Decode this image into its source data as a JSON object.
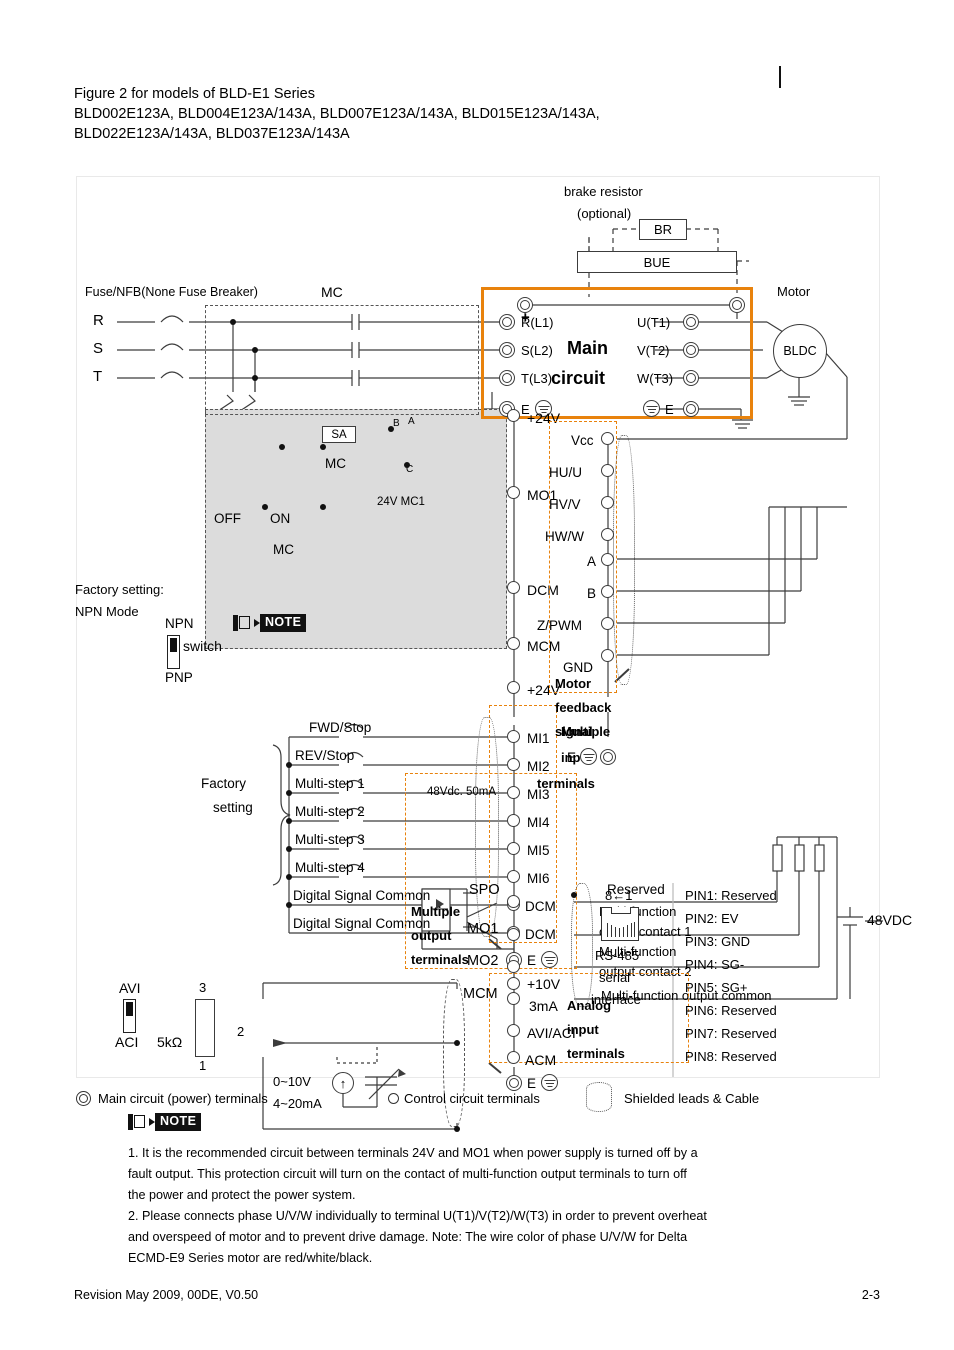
{
  "header": {
    "line1": "Figure 2 for models of BLD-E1 Series",
    "line2": "BLD002E123A, BLD004E123A/143A, BLD007E123A/143A, BLD015E123A/143A,",
    "line3": "BLD022E123A/143A, BLD037E123A/143A"
  },
  "diagram": {
    "brake": {
      "title_line1": "brake resistor",
      "title_line2": "(optional)",
      "br_label": "BR",
      "bue_label": "BUE"
    },
    "supply": {
      "fuse_label": "Fuse/NFB(None Fuse Breaker)",
      "mc_top_label": "MC",
      "phases": [
        "R",
        "S",
        "T"
      ],
      "sa_label": "SA",
      "mc_coil_label": "MC",
      "off_label": "OFF",
      "on_label": "ON",
      "mc_aux_label": "MC",
      "relay_label": "24V MC1",
      "relay_contacts": [
        "B",
        "A",
        "C"
      ]
    },
    "main_circuit": {
      "title_line1": "Main",
      "title_line2": "circuit",
      "plus_label": "+",
      "inputs": [
        "R(L1)",
        "S(L2)",
        "T(L3)",
        "E"
      ],
      "outputs": [
        "U(T1)",
        "V(T2)",
        "W(T3)",
        "E"
      ]
    },
    "motor": {
      "label": "Motor",
      "type": "BLDC"
    },
    "middle_terminals": [
      "+24V",
      "MO1",
      "DCM",
      "MCM"
    ],
    "input_block": {
      "factory_setting_label": "Factory setting:",
      "npn_mode_label": "NPN Mode",
      "npn_label": "NPN",
      "pnp_label": "PNP",
      "switch_label": "switch",
      "factory_label_line1": "Factory",
      "factory_label_line2": "setting",
      "plus24v_label": "+24V",
      "functions": [
        "FWD/Stop",
        "REV/Stop",
        "Multi-step 1",
        "Multi-step 2",
        "Multi-step 3",
        "Multi-step 4",
        "Digital Signal Common",
        "Digital Signal Common"
      ],
      "terminals": [
        "MI1",
        "MI2",
        "MI3",
        "MI4",
        "MI5",
        "MI6",
        "DCM",
        "DCM"
      ],
      "earth_label": "E",
      "group_label_line1": "Multiple",
      "group_label_line2": "input",
      "group_label_line3": "terminals"
    },
    "feedback_block": {
      "terminals": [
        "Vcc",
        "HU/U",
        "HV/V",
        "HW/W",
        "A",
        "B",
        "Z/PWM",
        "GND"
      ],
      "earth_label": "E",
      "group_label_line1": "Motor",
      "group_label_line2": "feedback",
      "group_label_line3": "signal"
    },
    "output_block": {
      "rating_label": "48Vdc. 50mA",
      "terminals": [
        "SPO",
        "MO1",
        "MO2",
        "MCM"
      ],
      "descriptions": [
        "Reserved",
        "Multi-function",
        "output contact 1",
        "Multi-function",
        "output contact 2",
        "Multi-function output common"
      ],
      "supply_label": "48VDC",
      "group_label_line1": "Multiple",
      "group_label_line2": "output",
      "group_label_line3": "terminals"
    },
    "analog_block": {
      "avi_label": "AVI",
      "aci_label": "ACI",
      "pot_value": "5kΩ",
      "pot_pins": [
        "3",
        "2",
        "1"
      ],
      "source_line1": "0~10V",
      "source_line2": "4~20mA",
      "terminals": [
        "+10V",
        "3mA",
        "AVI/ACI",
        "ACM"
      ],
      "earth_label": "E",
      "group_label_line1": "Analog",
      "group_label_line2": "input",
      "group_label_line3": "terminals"
    },
    "rs485": {
      "pin_order_label": "8←1",
      "name_line1": "RS-485",
      "name_line2": "serial",
      "name_line3": "interface",
      "pins": [
        "PIN1: Reserved",
        "PIN2: EV",
        "PIN3: GND",
        "PIN4: SG-",
        "PIN5: SG+",
        "PIN6: Reserved",
        "PIN7: Reserved",
        "PIN8: Reserved"
      ]
    },
    "legend": {
      "power_terminals": "Main circuit (power) terminals",
      "control_terminals": "Control circuit terminals",
      "shielded": "Shielded leads & Cable"
    }
  },
  "note_badge": "NOTE",
  "notes": {
    "n1_l1": "1. It is the recommended circuit between terminals 24V and MO1 when power supply is turned off by a",
    "n1_l2": "fault output. This protection circuit will turn on the contact of multi-function output terminals to turn off",
    "n1_l3": " the power and protect the power system.",
    "n2_l1": "2. Please connects phase U/V/W individually to terminal U(T1)/V(T2)/W(T3) in order to prevent overheat",
    "n2_l2": "and overspeed of motor and to prevent drive damage. Note: The wire color of phase U/V/W for Delta",
    "n2_l3": "ECMD-E9 Series motor are red/white/black."
  },
  "footer": {
    "revision": "Revision May 2009, 00DE, V0.50",
    "page": "2-3"
  },
  "colors": {
    "accent": "#e8820c",
    "wire": "#3c3c3c",
    "shade": "#dcdcdc"
  }
}
